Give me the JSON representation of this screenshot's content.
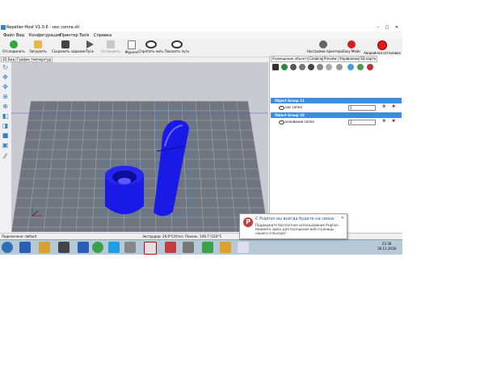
{
  "window": {
    "title": "Repetier-Host V1.0.6 - нос сопла.stl",
    "controls": [
      "–",
      "□",
      "✕"
    ]
  },
  "menu": [
    "Файл",
    "Вид",
    "Конфигурация",
    "Принтер",
    "Tools",
    "Справка"
  ],
  "toolbar": {
    "buttons": [
      {
        "label": "Отсоединить",
        "icon": "connect-icon"
      },
      {
        "label": "Загрузить",
        "icon": "load-icon"
      },
      {
        "label": "Сохранить задание",
        "icon": "save-job-icon"
      },
      {
        "label": "Пуск",
        "icon": "play-icon"
      },
      {
        "label": "Остановить",
        "icon": "stop-icon"
      },
      {
        "label": "Журнал",
        "icon": "log-icon"
      },
      {
        "label": "Спрятать нить",
        "icon": "eye-icon"
      },
      {
        "label": "Показать путь",
        "icon": "eye-icon"
      }
    ],
    "right_buttons": [
      {
        "label": "Настройки принтера",
        "icon": "gear-icon"
      },
      {
        "label": "Easy Mode",
        "icon": "easy-mode-icon"
      },
      {
        "label": "Аварийная остановка",
        "icon": "emergency-stop-icon"
      }
    ]
  },
  "left_tabs": [
    "3D Вид",
    "График температур"
  ],
  "right_tabs": [
    "Размещение объекта",
    "Слайсер",
    "Preview",
    "Управление",
    "SD карта"
  ],
  "groups": [
    {
      "name": "Object Group 11",
      "object": "нос сопла",
      "value": "1"
    },
    {
      "name": "Object Group 10",
      "object": "основание сопла",
      "value": "1"
    }
  ],
  "statusbar": {
    "left": "Подключено: default",
    "center": "Экструдер: 26,9°C/Откл. Панель: 149,7°/110°C"
  },
  "notification": {
    "title": "С Psiphon вы всегда будете на связи",
    "body": "Поддержите бесплатное использование Psiphon. Нажмите здесь для посещения веб-страницы нашего спонсора!",
    "close": "✕"
  },
  "clock": {
    "time": "22:38",
    "date": "30.11.2018"
  },
  "colors": {
    "accent": "#3c8ce0",
    "model": "#1a1ae6",
    "grid": "#6a6f7a",
    "viewport_bg": "#c9c9d1"
  }
}
